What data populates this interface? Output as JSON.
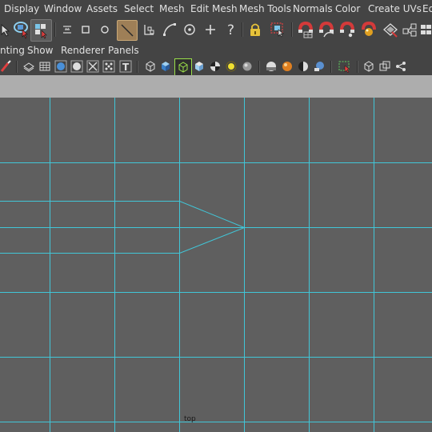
{
  "menubar": {
    "items": [
      "Display",
      "Window",
      "Assets",
      "Select",
      "Mesh",
      "Edit Mesh",
      "Mesh Tools",
      "Normals",
      "Color",
      "Create UVs",
      "Ed"
    ]
  },
  "panelbar": {
    "items": [
      "nting",
      "Show",
      "Renderer",
      "Panels"
    ]
  },
  "colors": {
    "ui_background": "#444444",
    "viewport_background": "#5f5f5f",
    "grid_line": "#41c6d8",
    "header_strip": "#adadad"
  },
  "toolbar1": {
    "icons": [
      "select-tool-icon",
      "lasso-select-icon",
      "paint-select-icon",
      "soft-select-icon",
      "square-marker-icon",
      "circle-marker-icon",
      "snap-to-grid-icon",
      "snap-to-vertex-icon",
      "snap-to-curve-icon",
      "snap-to-point-icon",
      "snap-plus-icon",
      "help-question-icon",
      "lock-icon",
      "select-camera-icon",
      "magnet-snap-icon",
      "magnet-curve-icon",
      "magnet-point-icon",
      "render-sphere-icon",
      "render-settings-icon",
      "node-editor-icon"
    ]
  },
  "toolbar2": {
    "icons": [
      "paint-brush-icon",
      "wireframe-icon",
      "grid-icon",
      "sphere-shade-icon",
      "circle-shade-icon",
      "checker-x-icon",
      "texture-icon",
      "text-t-icon",
      "cube-wire-icon",
      "cube-shaded-icon",
      "cube-select-icon",
      "cube-light-icon",
      "checker-icon",
      "light-bulb-icon",
      "sphere-gray-icon",
      "sphere-dark-icon",
      "sphere-orange-icon",
      "sphere-half-icon",
      "sphere-blue-icon",
      "select-frame-icon",
      "cube-outline-icon",
      "cube-double-icon",
      "share-icon"
    ]
  },
  "viewport": {
    "camera_label": "top"
  }
}
